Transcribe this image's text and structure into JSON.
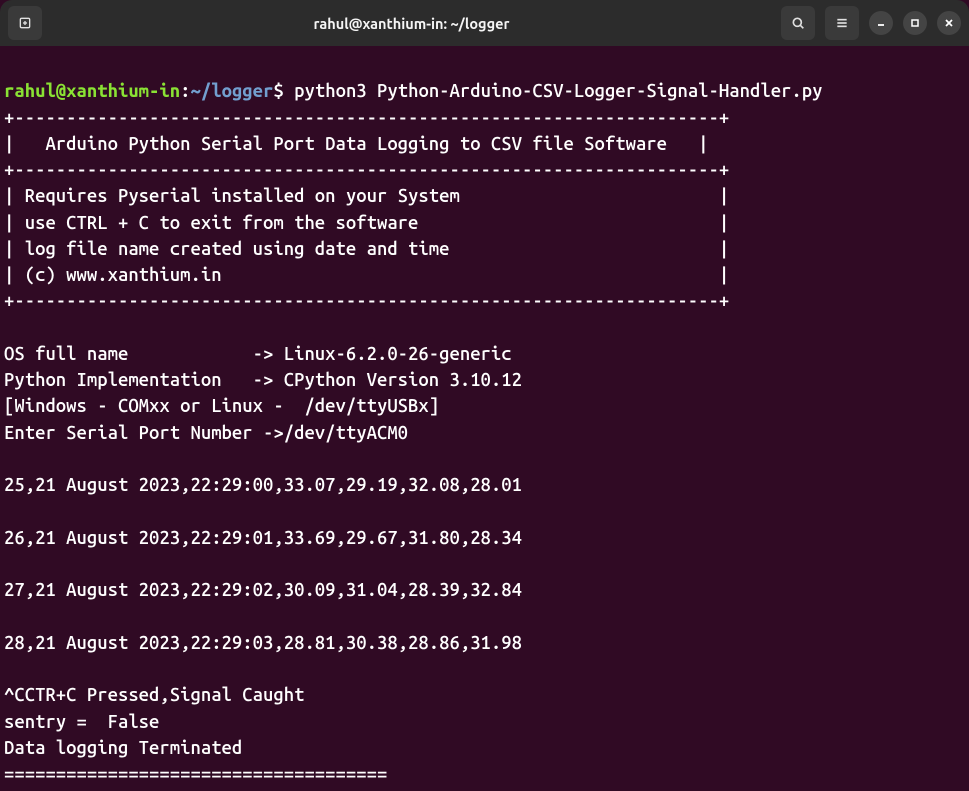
{
  "titlebar": {
    "title": "rahul@xanthium-in: ~/logger"
  },
  "prompt": {
    "user": "rahul@xanthium-in",
    "separator": ":",
    "path": "~/logger",
    "symbol": "$"
  },
  "command": "python3 Python-Arduino-CSV-Logger-Signal-Handler.py",
  "banner": {
    "border_top": "+--------------------------------------------------------------------+",
    "title_line": "|   Arduino Python Serial Port Data Logging to CSV file Software   |",
    "border_mid": "+--------------------------------------------------------------------+",
    "line1": "| Requires Pyserial installed on your System                         |",
    "line2": "| use CTRL + C to exit from the software                             |",
    "line3": "| log file name created using date and time                          |",
    "line4": "| (c) www.xanthium.in                                                |",
    "border_bottom": "+--------------------------------------------------------------------+"
  },
  "sysinfo": {
    "os_line": "OS full name            -> Linux-6.2.0-26-generic",
    "python_line": "Python Implementation   -> CPython Version 3.10.12",
    "hint_line": "[Windows - COMxx or Linux -  /dev/ttyUSBx]",
    "serial_prompt": "Enter Serial Port Number ->/dev/ttyACM0"
  },
  "data_rows": {
    "row1": "25,21 August 2023,22:29:00,33.07,29.19,32.08,28.01",
    "row2": "26,21 August 2023,22:29:01,33.69,29.67,31.80,28.34",
    "row3": "27,21 August 2023,22:29:02,30.09,31.04,28.39,32.84",
    "row4": "28,21 August 2023,22:29:03,28.81,30.38,28.86,31.98"
  },
  "footer": {
    "signal_line": "^CCTR+C Pressed,Signal Caught",
    "sentry_line": "sentry =  False",
    "terminated_line": "Data logging Terminated",
    "separator": "====================================="
  }
}
